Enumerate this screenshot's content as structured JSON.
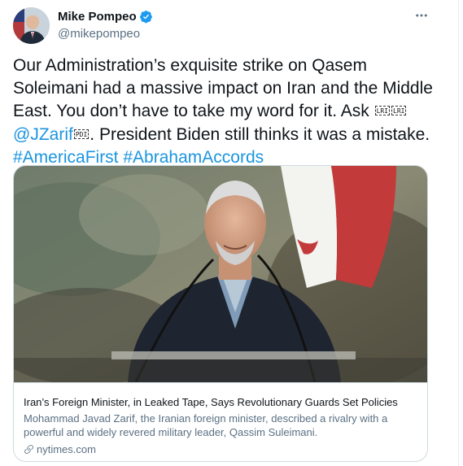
{
  "author": {
    "name": "Mike Pompeo",
    "handle": "@mikepompeo",
    "verified": true
  },
  "tweet": {
    "text_part1": "Our Administration’s exquisite strike on Qasem Soleimani had a massive impact on Iran and the Middle East.  You don’t have to take my word for it. Ask ",
    "ctrl_lri": "LRI",
    "mention": "@JZarif",
    "ctrl_pdi": "PDI",
    "text_part2": ". President Biden still thinks it was a mistake.  ",
    "hashtag1": "#AmericaFirst",
    "hashtag2": "#AbrahamAccords"
  },
  "card": {
    "title": "Iran’s Foreign Minister, in Leaked Tape, Says Revolutionary Guards Set Policies",
    "description": "Mohammad Javad Zarif, the Iranian foreign minister, described a rivalry with a powerful and widely revered military leader, Qassim Suleimani.",
    "domain": "nytimes.com",
    "domain_icon": "link-icon"
  },
  "icons": {
    "verified": "verified-badge-icon",
    "more": "more-horizontal-icon"
  },
  "colors": {
    "link": "#1b95e0",
    "secondary_text": "#5b7083",
    "border": "#cfd9de"
  }
}
